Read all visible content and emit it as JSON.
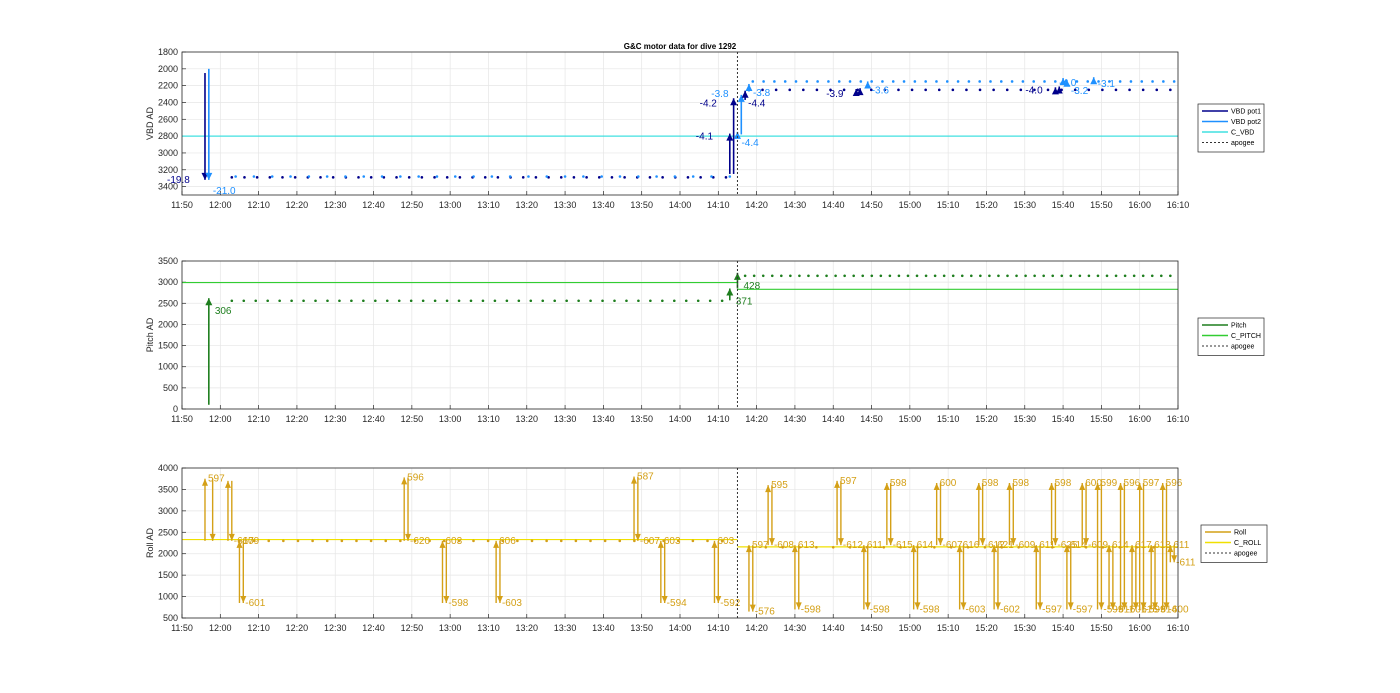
{
  "figure": {
    "title": "G&C motor data for dive 1292"
  },
  "colors": {
    "vbd1": "#00008b",
    "vbd2": "#1e90ff",
    "cvbd": "#40e0e0",
    "pitch": "#1e7e1e",
    "cpitch": "#32cd32",
    "roll": "#d4a017",
    "croll": "#f0e000",
    "apogee": "#333333",
    "grid": "#e6e6e6"
  },
  "chart_data": [
    {
      "type": "scatter",
      "id": "vbd",
      "ylabel": "VBD AD",
      "xlim": [
        "11:50",
        "16:10"
      ],
      "ylim": [
        1800,
        3500
      ],
      "y_reversed": true,
      "yticks": [
        1800,
        2000,
        2200,
        2400,
        2600,
        2800,
        3000,
        3200,
        3400
      ],
      "xticks": [
        "11:50",
        "12:00",
        "12:10",
        "12:20",
        "12:30",
        "12:40",
        "12:50",
        "13:00",
        "13:10",
        "13:20",
        "13:30",
        "13:40",
        "13:50",
        "14:00",
        "14:10",
        "14:20",
        "14:30",
        "14:40",
        "14:50",
        "15:00",
        "15:10",
        "15:20",
        "15:30",
        "15:40",
        "15:50",
        "16:00",
        "16:10"
      ],
      "apogee": "14:15",
      "reference_lines": [
        {
          "name": "C_VBD",
          "y": 2800
        }
      ],
      "legend": [
        {
          "name": "VBD pot1",
          "style": "line",
          "color_key": "vbd1"
        },
        {
          "name": "VBD pot2",
          "style": "line",
          "color_key": "vbd2"
        },
        {
          "name": "C_VBD",
          "style": "line",
          "color_key": "cvbd"
        },
        {
          "name": "apogee",
          "style": "dotted",
          "color_key": "apogee"
        }
      ],
      "dots": [
        {
          "series": "pot1",
          "color_key": "vbd1",
          "x_start": "12:03",
          "x_end": "14:12",
          "count": 40,
          "y": 3290
        },
        {
          "series": "pot2",
          "color_key": "vbd2",
          "x_start": "12:04",
          "x_end": "14:13",
          "count": 28,
          "y": 3280
        },
        {
          "series": "pot1",
          "color_key": "vbd1",
          "x_start": "14:18",
          "x_end": "16:08",
          "count": 32,
          "y": 2250
        },
        {
          "series": "pot2",
          "color_key": "vbd2",
          "x_start": "14:19",
          "x_end": "16:09",
          "count": 40,
          "y": 2150
        }
      ],
      "arrows": [
        {
          "x": "11:56",
          "from": 2050,
          "to": 3320,
          "color_key": "vbd1",
          "label": "-19.8",
          "lx": -38,
          "ly": 3
        },
        {
          "x": "11:57",
          "from": 2000,
          "to": 3320,
          "color_key": "vbd2",
          "label": "-21.0",
          "lx": 4,
          "ly": 14
        },
        {
          "x": "14:13",
          "from": 3250,
          "to": 2770,
          "color_key": "vbd1",
          "label": "-4.1",
          "lx": -34,
          "ly": 6
        },
        {
          "x": "14:14",
          "from": 3250,
          "to": 2350,
          "color_key": "vbd1",
          "label": "-4.2",
          "lx": -34,
          "ly": 8
        },
        {
          "x": "14:15",
          "from": 2780,
          "to": 2750,
          "color_key": "vbd2",
          "label": "-4.4",
          "lx": 4,
          "ly": 14
        },
        {
          "x": "14:16",
          "from": 2780,
          "to": 2310,
          "color_key": "vbd2",
          "label": "-3.8",
          "lx": -30,
          "ly": 2
        },
        {
          "x": "14:17",
          "from": 2370,
          "to": 2260,
          "color_key": "vbd1",
          "label": "-4.4",
          "lx": 3,
          "ly": 16
        },
        {
          "x": "14:18",
          "from": 2270,
          "to": 2180,
          "color_key": "vbd2",
          "label": "-3.8",
          "lx": 4,
          "ly": 12
        },
        {
          "x": "14:46",
          "from": 2310,
          "to": 2240,
          "color_key": "vbd1",
          "label": "-3.9",
          "lx": -30,
          "ly": 8
        },
        {
          "x": "14:47",
          "from": 2300,
          "to": 2230,
          "color_key": "vbd1",
          "label": "",
          "lx": 0,
          "ly": 0
        },
        {
          "x": "14:49",
          "from": 2210,
          "to": 2150,
          "color_key": "vbd2",
          "label": "-3.6",
          "lx": 4,
          "ly": 12
        },
        {
          "x": "15:38",
          "from": 2290,
          "to": 2220,
          "color_key": "vbd1",
          "label": "-4.0",
          "lx": -30,
          "ly": 6
        },
        {
          "x": "15:39",
          "from": 2280,
          "to": 2210,
          "color_key": "vbd1",
          "label": "",
          "lx": 0,
          "ly": 0
        },
        {
          "x": "15:40",
          "from": 2190,
          "to": 2110,
          "color_key": "vbd2",
          "label": "-4.0",
          "lx": -4,
          "ly": 8
        },
        {
          "x": "15:41",
          "from": 2190,
          "to": 2130,
          "color_key": "vbd2",
          "label": "-3.2",
          "lx": 4,
          "ly": 14
        },
        {
          "x": "15:48",
          "from": 2160,
          "to": 2100,
          "color_key": "vbd2",
          "label": "-3.1",
          "lx": 4,
          "ly": 10
        }
      ]
    },
    {
      "type": "scatter",
      "id": "pitch",
      "ylabel": "Pitch AD",
      "xlim": [
        "11:50",
        "16:10"
      ],
      "ylim": [
        0,
        3500
      ],
      "y_reversed": false,
      "yticks": [
        0,
        500,
        1000,
        1500,
        2000,
        2500,
        3000,
        3500
      ],
      "xticks": [
        "11:50",
        "12:00",
        "12:10",
        "12:20",
        "12:30",
        "12:40",
        "12:50",
        "13:00",
        "13:10",
        "13:20",
        "13:30",
        "13:40",
        "13:50",
        "14:00",
        "14:10",
        "14:20",
        "14:30",
        "14:40",
        "14:50",
        "15:00",
        "15:10",
        "15:20",
        "15:30",
        "15:40",
        "15:50",
        "16:00",
        "16:10"
      ],
      "apogee": "14:15",
      "reference_lines": [
        {
          "name": "C_PITCH",
          "y": 2990,
          "x_end": "14:15"
        },
        {
          "name": "C_PITCH",
          "y": 2830,
          "x_start": "14:15"
        }
      ],
      "legend": [
        {
          "name": "Pitch",
          "style": "line",
          "color_key": "pitch"
        },
        {
          "name": "C_PITCH",
          "style": "line",
          "color_key": "cpitch"
        },
        {
          "name": "apogee",
          "style": "dotted",
          "color_key": "apogee"
        }
      ],
      "dots": [
        {
          "series": "pitch",
          "color_key": "pitch",
          "x_start": "12:03",
          "x_end": "14:11",
          "count": 42,
          "y": 2560
        },
        {
          "series": "pitch",
          "color_key": "pitch",
          "x_start": "14:17",
          "x_end": "16:08",
          "count": 48,
          "y": 3150
        }
      ],
      "arrows": [
        {
          "x": "11:57",
          "from": 100,
          "to": 2620,
          "color_key": "pitch",
          "label": "306",
          "lx": 6,
          "ly": 16
        },
        {
          "x": "14:13",
          "from": 2570,
          "to": 2850,
          "color_key": "pitch",
          "label": "371",
          "lx": 6,
          "ly": 16
        },
        {
          "x": "14:15",
          "from": 2850,
          "to": 3220,
          "color_key": "pitch",
          "label": "428",
          "lx": 6,
          "ly": 16
        }
      ]
    },
    {
      "type": "scatter",
      "id": "roll",
      "ylabel": "Roll AD",
      "xlim": [
        "11:50",
        "16:10"
      ],
      "ylim": [
        500,
        4000
      ],
      "y_reversed": false,
      "yticks": [
        500,
        1000,
        1500,
        2000,
        2500,
        3000,
        3500,
        4000
      ],
      "xticks": [
        "11:50",
        "12:00",
        "12:10",
        "12:20",
        "12:30",
        "12:40",
        "12:50",
        "13:00",
        "13:10",
        "13:20",
        "13:30",
        "13:40",
        "13:50",
        "14:00",
        "14:10",
        "14:20",
        "14:30",
        "14:40",
        "14:50",
        "15:00",
        "15:10",
        "15:20",
        "15:30",
        "15:40",
        "15:50",
        "16:00",
        "16:10"
      ],
      "apogee": "14:15",
      "reference_lines": [
        {
          "name": "C_ROLL",
          "y": 2330,
          "x_end": "14:15"
        },
        {
          "name": "C_ROLL",
          "y": 2160,
          "x_start": "14:15"
        }
      ],
      "legend": [
        {
          "name": "Roll",
          "style": "line",
          "color_key": "roll"
        },
        {
          "name": "C_ROLL",
          "style": "line",
          "color_key": "croll"
        },
        {
          "name": "apogee",
          "style": "dotted",
          "color_key": "apogee"
        }
      ],
      "dots": [
        {
          "series": "roll",
          "color_key": "roll",
          "x_start": "12:05",
          "x_end": "14:11",
          "count": 34,
          "y": 2300
        },
        {
          "series": "roll",
          "color_key": "roll",
          "x_start": "14:18",
          "x_end": "16:08",
          "count": 26,
          "y": 2150
        }
      ],
      "pulses": [
        {
          "x1": "11:56",
          "x2": "11:58",
          "high": 3750,
          "low": 2300,
          "label_high": "597",
          "label_low": "",
          "dir": "up"
        },
        {
          "x1": "12:02",
          "x2": "12:03",
          "high": 3700,
          "low": 2300,
          "label_high": "",
          "label_low": "-617",
          "dir": "down"
        },
        {
          "x1": "12:05",
          "x2": "12:06",
          "high": 2300,
          "low": 850,
          "label_high": "609",
          "label_low": "-601",
          "dir": "down"
        },
        {
          "x1": "12:48",
          "x2": "12:49",
          "high": 3780,
          "low": 2300,
          "label_high": "596",
          "label_low": "-620",
          "dir": "both"
        },
        {
          "x1": "12:58",
          "x2": "12:59",
          "high": 2300,
          "low": 850,
          "label_high": "603",
          "label_low": "-598",
          "dir": "both"
        },
        {
          "x1": "13:12",
          "x2": "13:13",
          "high": 2300,
          "low": 850,
          "label_high": "606",
          "label_low": "-603",
          "dir": "both"
        },
        {
          "x1": "13:48",
          "x2": "13:49",
          "high": 3800,
          "low": 2300,
          "label_high": "587",
          "label_low": "-607",
          "dir": "both"
        },
        {
          "x1": "13:55",
          "x2": "13:56",
          "high": 2300,
          "low": 850,
          "label_high": "603",
          "label_low": "-594",
          "dir": "both"
        },
        {
          "x1": "14:09",
          "x2": "14:10",
          "high": 2300,
          "low": 850,
          "label_high": "603",
          "label_low": "-592",
          "dir": "both"
        },
        {
          "x1": "14:18",
          "x2": "14:19",
          "high": 2200,
          "low": 650,
          "label_high": "597",
          "label_low": "-576",
          "dir": "both"
        },
        {
          "x1": "14:23",
          "x2": "14:24",
          "high": 3600,
          "low": 2200,
          "label_high": "595",
          "label_low": "-608",
          "dir": "both"
        },
        {
          "x1": "14:30",
          "x2": "14:31",
          "high": 2200,
          "low": 700,
          "label_high": "613",
          "label_low": "-598",
          "dir": "both"
        },
        {
          "x1": "14:41",
          "x2": "14:42",
          "high": 3700,
          "low": 2200,
          "label_high": "597",
          "label_low": "-612",
          "dir": "both"
        },
        {
          "x1": "14:48",
          "x2": "14:49",
          "high": 2200,
          "low": 700,
          "label_high": "611",
          "label_low": "-598",
          "dir": "both"
        },
        {
          "x1": "14:54",
          "x2": "14:55",
          "high": 3650,
          "low": 2200,
          "label_high": "598",
          "label_low": "-615",
          "dir": "both"
        },
        {
          "x1": "15:01",
          "x2": "15:02",
          "high": 2200,
          "low": 700,
          "label_high": "614",
          "label_low": "-598",
          "dir": "both"
        },
        {
          "x1": "15:07",
          "x2": "15:08",
          "high": 3650,
          "low": 2200,
          "label_high": "600",
          "label_low": "-607",
          "dir": "both"
        },
        {
          "x1": "15:13",
          "x2": "15:14",
          "high": 2200,
          "low": 700,
          "label_high": "616",
          "label_low": "-603",
          "dir": "both"
        },
        {
          "x1": "15:18",
          "x2": "15:19",
          "high": 3650,
          "low": 2200,
          "label_high": "598",
          "label_low": "-612",
          "dir": "both"
        },
        {
          "x1": "15:22",
          "x2": "15:23",
          "high": 2200,
          "low": 700,
          "label_high": "621",
          "label_low": "-602",
          "dir": "both"
        },
        {
          "x1": "15:26",
          "x2": "15:27",
          "high": 3650,
          "low": 2200,
          "label_high": "598",
          "label_low": "-609",
          "dir": "both"
        },
        {
          "x1": "15:33",
          "x2": "15:34",
          "high": 2200,
          "low": 700,
          "label_high": "611",
          "label_low": "-597",
          "dir": "both"
        },
        {
          "x1": "15:37",
          "x2": "15:38",
          "high": 3650,
          "low": 2200,
          "label_high": "598",
          "label_low": "-625",
          "dir": "both"
        },
        {
          "x1": "15:41",
          "x2": "15:42",
          "high": 2200,
          "low": 700,
          "label_high": "614",
          "label_low": "-597",
          "dir": "both"
        },
        {
          "x1": "15:45",
          "x2": "15:46",
          "high": 3650,
          "low": 2200,
          "label_high": "600",
          "label_low": "-609",
          "dir": "both"
        },
        {
          "x1": "15:49",
          "x2": "15:50",
          "high": 3650,
          "low": 700,
          "label_high": "599",
          "label_low": "-599",
          "dir": "both"
        },
        {
          "x1": "15:52",
          "x2": "15:53",
          "high": 2200,
          "low": 700,
          "label_high": "614",
          "label_low": "-611",
          "dir": "both"
        },
        {
          "x1": "15:55",
          "x2": "15:56",
          "high": 3650,
          "low": 700,
          "label_high": "596",
          "label_low": "-601",
          "dir": "both"
        },
        {
          "x1": "15:58",
          "x2": "15:59",
          "high": 2200,
          "low": 700,
          "label_high": "617",
          "label_low": "-616",
          "dir": "both"
        },
        {
          "x1": "16:00",
          "x2": "16:01",
          "high": 3650,
          "low": 700,
          "label_high": "597",
          "label_low": "-599",
          "dir": "both"
        },
        {
          "x1": "16:03",
          "x2": "16:04",
          "high": 2200,
          "low": 700,
          "label_high": "613",
          "label_low": "-614",
          "dir": "both"
        },
        {
          "x1": "16:06",
          "x2": "16:07",
          "high": 3650,
          "low": 700,
          "label_high": "596",
          "label_low": "-600",
          "dir": "both"
        },
        {
          "x1": "16:08",
          "x2": "16:09",
          "high": 2200,
          "low": 1800,
          "label_high": "611",
          "label_low": "-611",
          "dir": "both"
        }
      ]
    }
  ]
}
